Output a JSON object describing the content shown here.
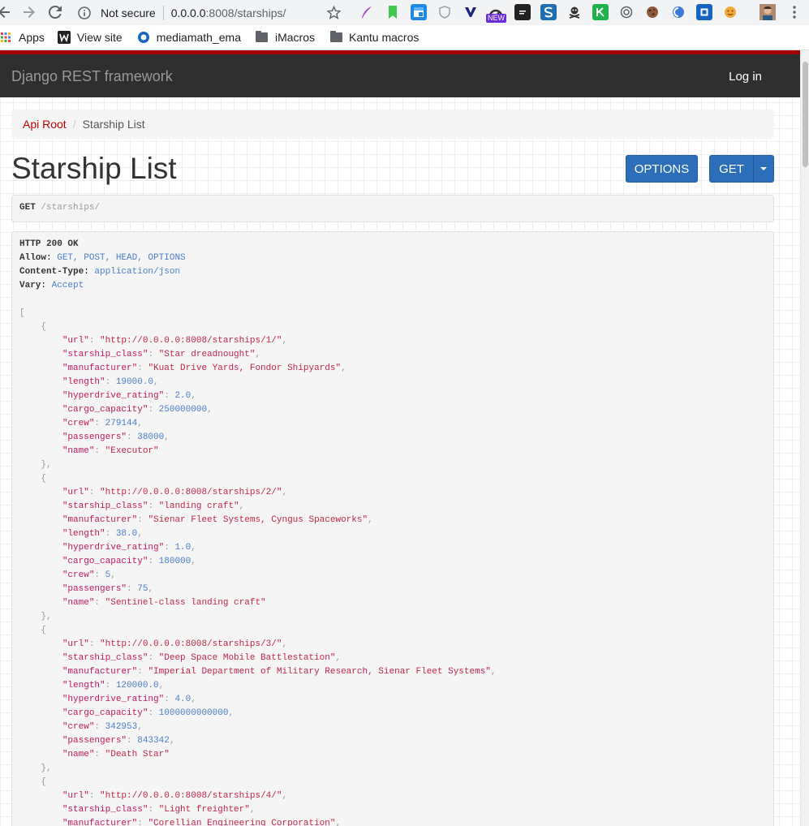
{
  "browser": {
    "security_label": "Not secure",
    "url_host": "0.0.0.0",
    "url_path": ":8008/starships/",
    "extension_badge": "NEW"
  },
  "bookmarks": [
    {
      "label": "Apps",
      "icon": "apps-grid-icon"
    },
    {
      "label": "View site",
      "icon": "w-logo-icon"
    },
    {
      "label": "mediamath_ema",
      "icon": "circle-logo-icon"
    },
    {
      "label": "iMacros",
      "icon": "folder-icon"
    },
    {
      "label": "Kantu macros",
      "icon": "folder-icon"
    }
  ],
  "navbar": {
    "brand": "Django REST framework",
    "login": "Log in",
    "accent_color": "#a30000"
  },
  "breadcrumb": {
    "root": "Api Root",
    "current": "Starship List"
  },
  "page_title": "Starship List",
  "buttons": {
    "options": "OPTIONS",
    "get": "GET"
  },
  "request": {
    "method": "GET",
    "path": "/starships/"
  },
  "response": {
    "status": "HTTP 200 OK",
    "headers": [
      {
        "key": "Allow",
        "value": "GET, POST, HEAD, OPTIONS"
      },
      {
        "key": "Content-Type",
        "value": "application/json"
      },
      {
        "key": "Vary",
        "value": "Accept"
      }
    ],
    "items": [
      {
        "url": "\"http://0.0.0.0:8008/starships/1/\"",
        "starship_class": "\"Star dreadnought\"",
        "manufacturer": "\"Kuat Drive Yards, Fondor Shipyards\"",
        "length": "19000.0",
        "hyperdrive_rating": "2.0",
        "cargo_capacity": "250000000",
        "crew": "279144",
        "passengers": "38000",
        "name": "\"Executor\""
      },
      {
        "url": "\"http://0.0.0.0:8008/starships/2/\"",
        "starship_class": "\"landing craft\"",
        "manufacturer": "\"Sienar Fleet Systems, Cyngus Spaceworks\"",
        "length": "38.0",
        "hyperdrive_rating": "1.0",
        "cargo_capacity": "180000",
        "crew": "5",
        "passengers": "75",
        "name": "\"Sentinel-class landing craft\""
      },
      {
        "url": "\"http://0.0.0.0:8008/starships/3/\"",
        "starship_class": "\"Deep Space Mobile Battlestation\"",
        "manufacturer": "\"Imperial Department of Military Research, Sienar Fleet Systems\"",
        "length": "120000.0",
        "hyperdrive_rating": "4.0",
        "cargo_capacity": "1000000000000",
        "crew": "342953",
        "passengers": "843342",
        "name": "\"Death Star\""
      },
      {
        "url": "\"http://0.0.0.0:8008/starships/4/\"",
        "starship_class": "\"Light freighter\"",
        "manufacturer": "\"Corellian Engineering Corporation\""
      }
    ]
  }
}
